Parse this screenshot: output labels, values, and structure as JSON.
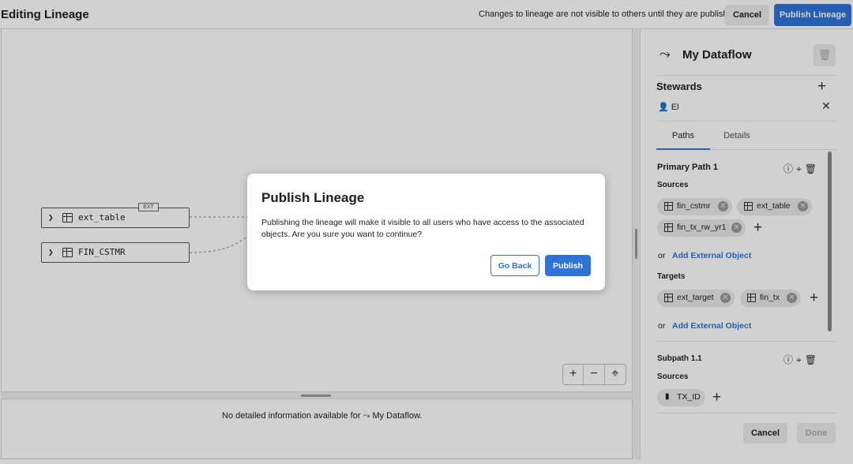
{
  "header": {
    "title": "Editing Lineage",
    "notice": "Changes to lineage are not visible to others until they are published",
    "cancel_label": "Cancel",
    "publish_label": "Publish Lineage"
  },
  "canvas": {
    "nodes": [
      {
        "label": "ext_table",
        "badge": "EXT"
      },
      {
        "label": "FIN_CSTMR"
      }
    ],
    "zoom_controls": [
      "+",
      "−",
      "⌖"
    ]
  },
  "bottom_panel": {
    "message": "No detailed information available for",
    "dataflow_name": "My Dataflow."
  },
  "right_panel": {
    "title": "My Dataflow",
    "stewards_heading": "Stewards",
    "steward": "El",
    "tabs": [
      {
        "label": "Paths",
        "active": true
      },
      {
        "label": "Details",
        "active": false
      }
    ],
    "primary_path": {
      "title": "Primary Path 1",
      "sources_label": "Sources",
      "sources": [
        "fin_cstmr",
        "ext_table",
        "fin_tx_rw_yr1"
      ],
      "or_label": "or",
      "add_external": "Add External Object",
      "targets_label": "Targets",
      "targets": [
        "ext_target",
        "fin_tx"
      ]
    },
    "subpath": {
      "title": "Subpath 1.1",
      "sources_label": "Sources",
      "sources": [
        "TX_ID"
      ]
    },
    "cancel_label": "Cancel",
    "done_label": "Done"
  },
  "modal": {
    "title": "Publish Lineage",
    "body": "Publishing the lineage will make it visible to all users who have access to the associated objects. Are you sure you want to continue?",
    "go_back_label": "Go Back",
    "publish_label": "Publish"
  },
  "colors": {
    "accent": "#2f73d9",
    "overlay": "rgba(0,0,0,0.18)"
  }
}
